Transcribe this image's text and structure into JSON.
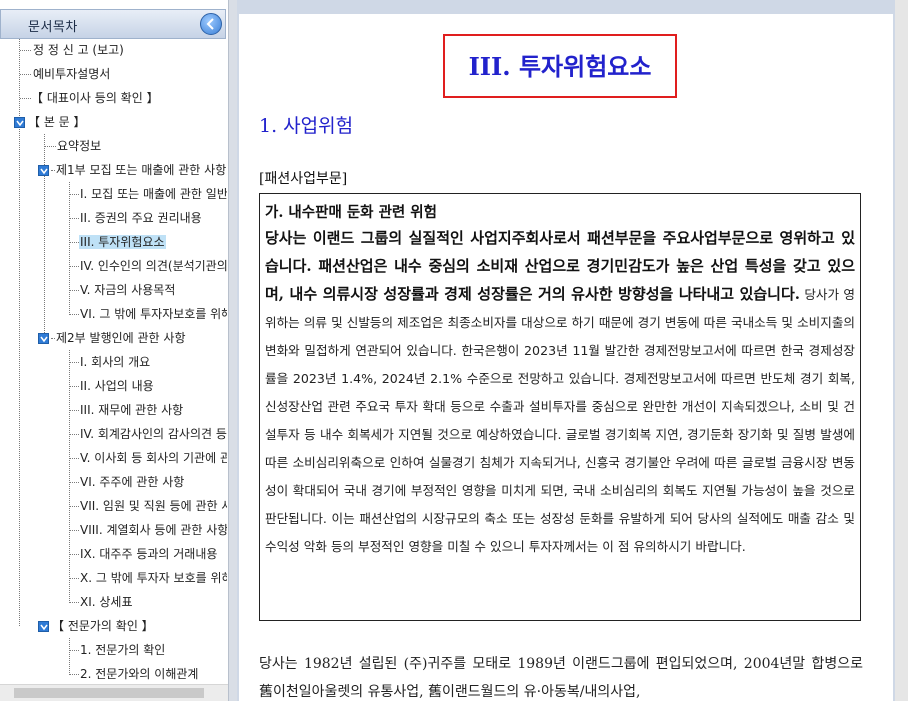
{
  "toc": {
    "header_title": "문서목차",
    "items": [
      {
        "label": "정 정 신 고 (보고)"
      },
      {
        "label": "예비투자설명서"
      },
      {
        "label": "【 대표이사 등의 확인 】"
      },
      {
        "label": "【 본 문 】"
      },
      {
        "label": "요약정보"
      },
      {
        "label": "제1부 모집 또는 매출에 관한 사항"
      },
      {
        "label": "I. 모집 또는 매출에 관한 일반사항"
      },
      {
        "label": "II. 증권의 주요 권리내용"
      },
      {
        "label": "III. 투자위험요소"
      },
      {
        "label": "IV. 인수인의 의견(분석기관의 평가의견)"
      },
      {
        "label": "V. 자금의 사용목적"
      },
      {
        "label": "VI. 그 밖에 투자자보호를 위해 필요한 사항"
      },
      {
        "label": "제2부 발행인에 관한 사항"
      },
      {
        "label": "I. 회사의 개요"
      },
      {
        "label": "II. 사업의 내용"
      },
      {
        "label": "III. 재무에 관한 사항"
      },
      {
        "label": "IV. 회계감사인의 감사의견 등"
      },
      {
        "label": "V. 이사회 등 회사의 기관에 관한 사항"
      },
      {
        "label": "VI. 주주에 관한 사항"
      },
      {
        "label": "VII. 임원 및 직원 등에 관한 사항"
      },
      {
        "label": "VIII. 계열회사 등에 관한 사항"
      },
      {
        "label": "IX. 대주주 등과의 거래내용"
      },
      {
        "label": "X. 그 밖에 투자자 보호를 위하여 필요한 사항"
      },
      {
        "label": "XI. 상세표"
      },
      {
        "label": "【 전문가의 확인 】"
      },
      {
        "label": "1. 전문가의 확인"
      },
      {
        "label": "2. 전문가와의 이해관계"
      }
    ]
  },
  "document": {
    "section_title": "III. 투자위험요소",
    "sub_heading": "1. 사업위험",
    "category": "[패션사업부문]",
    "risk_heading": "가. 내수판매 둔화 관련 위험",
    "risk_bold": "당사는 이랜드 그룹의 실질적인 사업지주회사로서 패션부문을 주요사업부문으로 영위하고 있습니다. 패션산업은 내수 중심의 소비재 산업으로 경기민감도가 높은 산업 특성을 갖고 있으며, 내수 의류시장 성장률과 경제 성장률은 거의 유사한 방향성을 나타내고 있습니다.",
    "risk_normal": " 당사가 영위하는 의류 및 신발등의 제조업은 최종소비자를 대상으로 하기 때문에 경기 변동에 따른 국내소득 및 소비지출의 변화와 밀접하게 연관되어 있습니다. 한국은행이 2023년 11월 발간한 경제전망보고서에 따르면 한국 경제성장률을 2023년 1.4%, 2024년 2.1% 수준으로 전망하고 있습니다. 경제전망보고서에 따르면 반도체 경기 회복, 신성장산업 관련 주요국 투자 확대 등으로 수출과 설비투자를 중심으로 완만한 개선이 지속되겠으나, 소비 및 건설투자 등 내수 회복세가 지연될 것으로 예상하였습니다. 글로벌 경기회복 지연, 경기둔화 장기화 및 질병 발생에 따른 소비심리위축으로 인하여 실물경기 침체가 지속되거나, 신흥국 경기불안 우려에 따른 글로벌 금융시장 변동성이 확대되어 국내 경기에 부정적인 영향을 미치게 되면, 국내 소비심리의 회복도 지연될 가능성이 높을 것으로 판단됩니다. 이는 패션산업의 시장규모의 축소 또는 성장성 둔화를 유발하게 되어 당사의 실적에도 매출 감소 및 수익성 악화 등의 부정적인 영향을 미칠 수 있으니 투자자께서는 이 점 유의하시기 바랍니다.",
    "history_para": "당사는 1982년 설립된 (주)귀주를 모태로 1989년 이랜드그룹에 편입되었으며, 2004년말 합병으로 舊이천일아울렛의 유통사업, 舊이랜드월드의 유·아동복/내의사업,"
  },
  "colors": {
    "title_blue": "#2222cc",
    "highlight_red": "#e01e1e",
    "selection": "#bfe1f6",
    "toggle_blue": "#2f7bd6"
  }
}
